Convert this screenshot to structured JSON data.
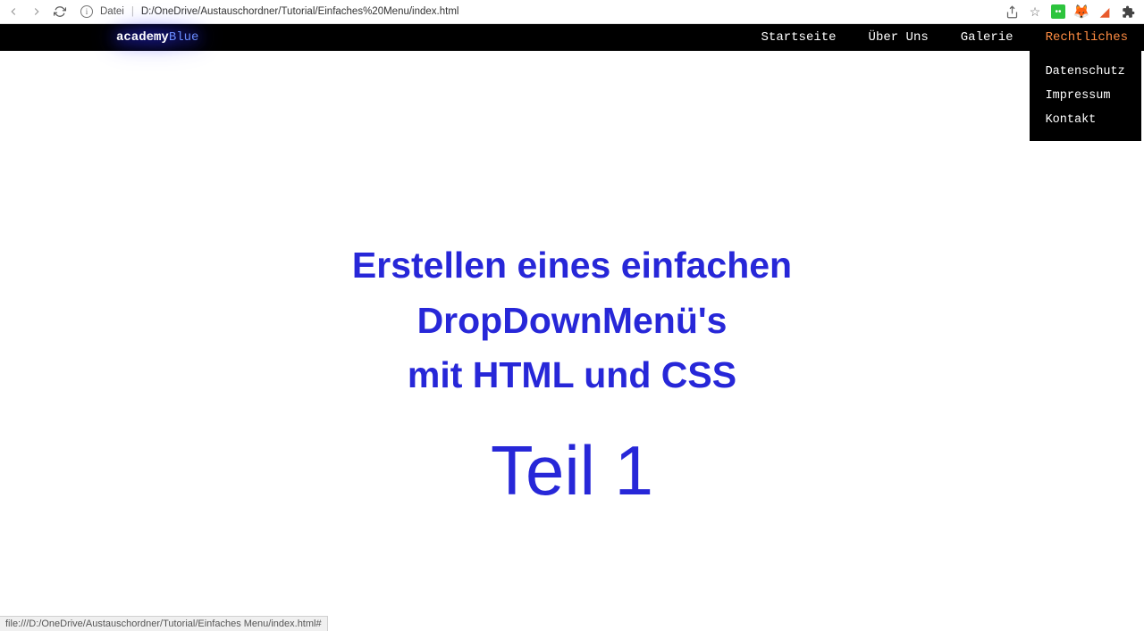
{
  "browser": {
    "address_label": "Datei",
    "url": "D:/OneDrive/Austauschordner/Tutorial/Einfaches%20Menu/index.html"
  },
  "logo": {
    "part1": "academy",
    "part2": "Blue"
  },
  "nav": {
    "items": [
      {
        "label": "Startseite"
      },
      {
        "label": "Über Uns"
      },
      {
        "label": "Galerie"
      },
      {
        "label": "Rechtliches"
      }
    ],
    "dropdown": [
      {
        "label": "Datenschutz"
      },
      {
        "label": "Impressum"
      },
      {
        "label": "Kontakt"
      }
    ]
  },
  "content": {
    "heading_line1": "Erstellen eines einfachen",
    "heading_line2": "DropDownMenü's",
    "heading_line3": "mit HTML und CSS",
    "subheading": "Teil 1"
  },
  "status": "file:///D:/OneDrive/Austauschordner/Tutorial/Einfaches Menu/index.html#"
}
